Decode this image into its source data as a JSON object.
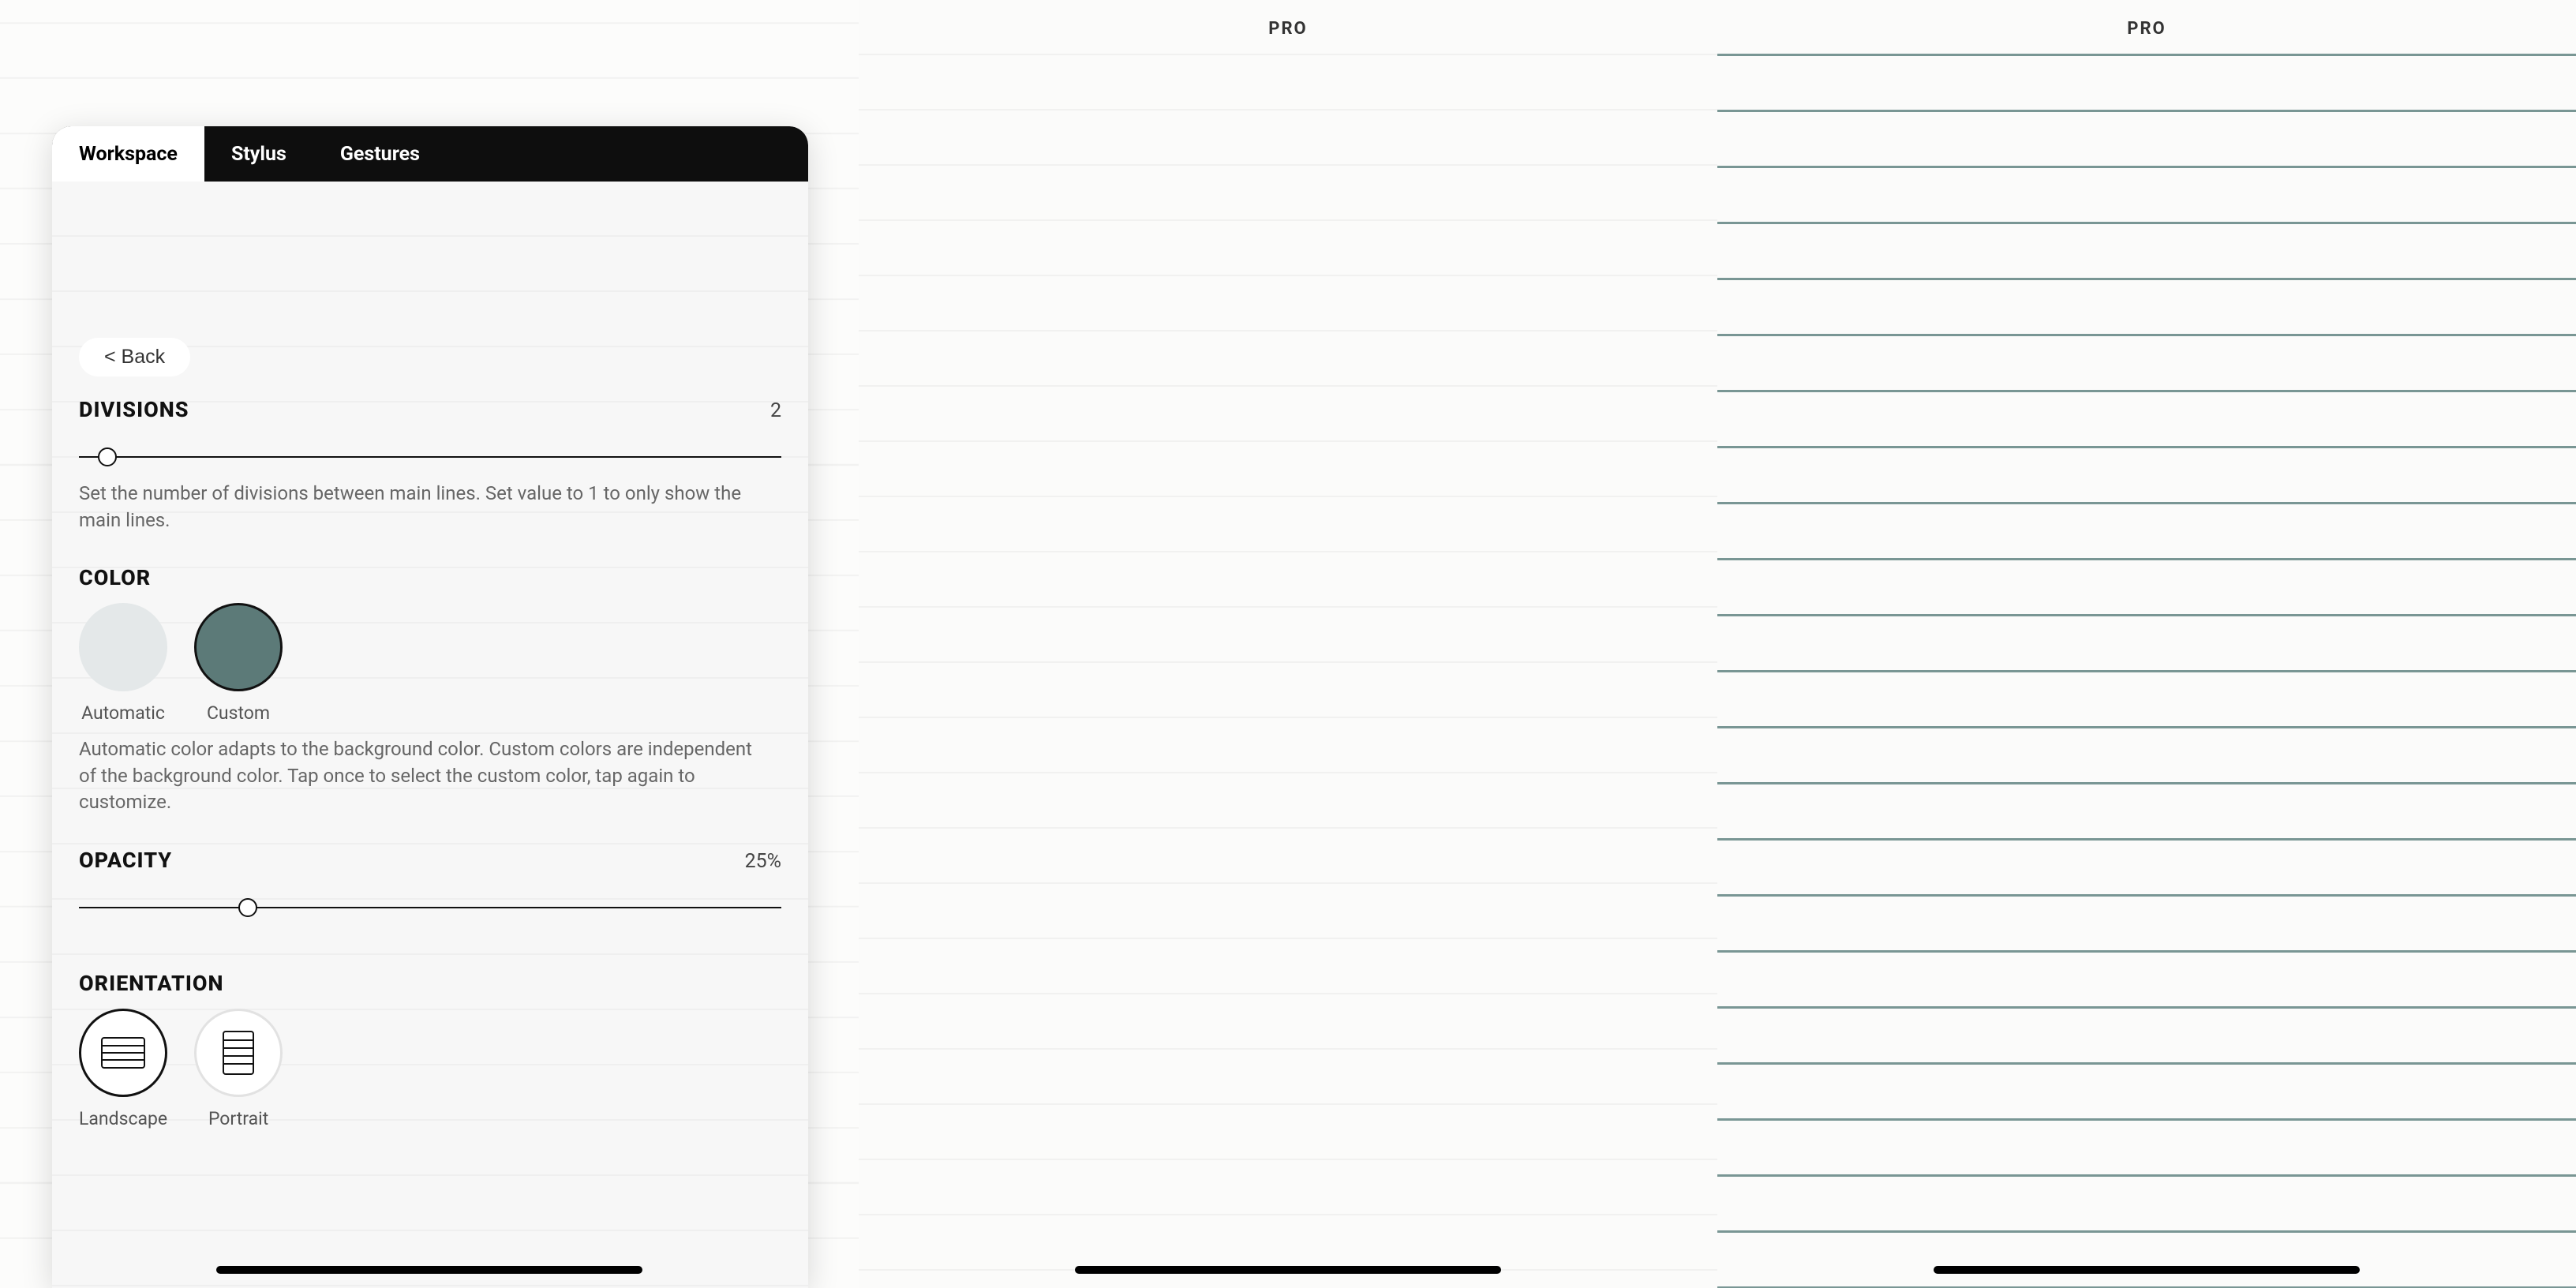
{
  "left": {
    "tabs": {
      "workspace": "Workspace",
      "stylus": "Stylus",
      "gestures": "Gestures"
    },
    "back_label": "< Back",
    "divisions": {
      "title": "DIVISIONS",
      "value": "2",
      "slider_percent": 4,
      "desc": "Set the number of divisions between main lines. Set value to 1 to only show the main lines."
    },
    "color": {
      "title": "COLOR",
      "automatic_label": "Automatic",
      "custom_label": "Custom",
      "custom_hex": "#5c7a78",
      "desc": "Automatic color adapts to the background color. Custom colors are independent of the background color. Tap once to select the custom color, tap again to customize."
    },
    "opacity": {
      "title": "OPACITY",
      "value": "25%",
      "slider_percent": 24
    },
    "orientation": {
      "title": "ORIENTATION",
      "landscape_label": "Landscape",
      "portrait_label": "Portrait"
    }
  },
  "middle": {
    "badge": "PRO"
  },
  "right": {
    "badge": "PRO",
    "line_color": "#799694"
  }
}
